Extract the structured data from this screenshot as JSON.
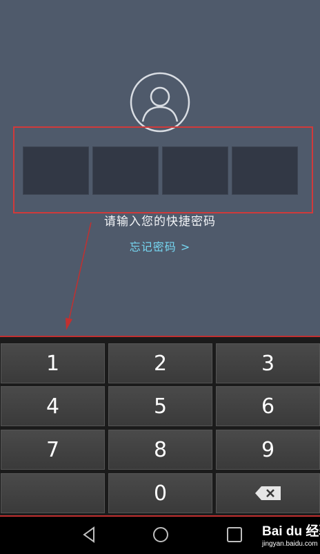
{
  "lock_screen": {
    "prompt": "请输入您的快捷密码",
    "forgot_link": "忘记密码 >"
  },
  "keypad": {
    "keys": [
      {
        "label": "1"
      },
      {
        "label": "2"
      },
      {
        "label": "3"
      },
      {
        "label": "4"
      },
      {
        "label": "5"
      },
      {
        "label": "6"
      },
      {
        "label": "7"
      },
      {
        "label": "8"
      },
      {
        "label": "9"
      },
      {
        "label": ""
      },
      {
        "label": "0"
      },
      {
        "label": "backspace-icon"
      }
    ]
  },
  "watermark": {
    "brand": "Bai du 经验",
    "url": "jingyan.baidu.com"
  },
  "colors": {
    "screen_bg": "#4f5a6b",
    "pin_cell": "#323845",
    "annotation_red": "#d13a3a",
    "link_blue": "#76d7f2"
  }
}
